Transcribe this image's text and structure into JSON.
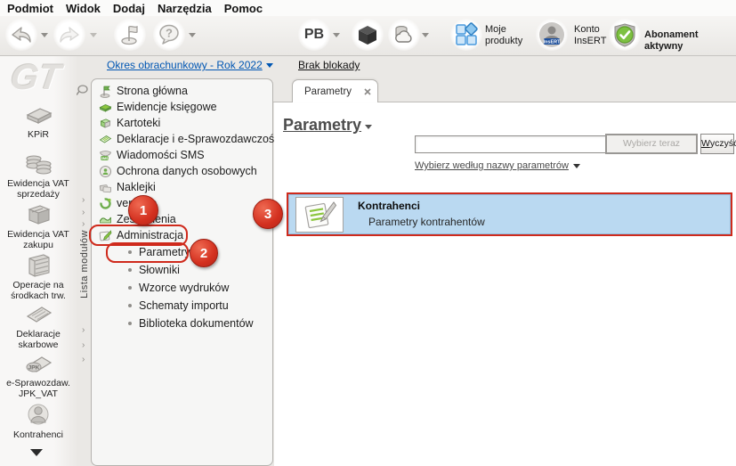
{
  "colors": {
    "accent_red": "#cf2a1c",
    "selection_blue": "#bad9f1",
    "link_blue": "#0056b3",
    "green": "#6fae4e"
  },
  "menu": {
    "items": [
      "Podmiot",
      "Widok",
      "Dodaj",
      "Narzędzia",
      "Pomoc"
    ]
  },
  "toolbar": {
    "pb_label": "PB",
    "moje_produkty_line1": "Moje",
    "moje_produkty_line2": "produkty",
    "konto_line1": "Konto",
    "konto_line2": "InsERT",
    "insert_badge": "InsERT",
    "abonament_label": "Abonament aktywny"
  },
  "icons": {
    "help_glyph": "?",
    "jpk_glyph": "JPK",
    "sms_glyph": "SMS"
  },
  "sidebar": {
    "logo": "GT",
    "strip_label": "Lista modułów",
    "modules": [
      {
        "label": "KPiR"
      },
      {
        "label": "Ewidencja VAT sprzedaży"
      },
      {
        "label": "Ewidencja VAT zakupu"
      },
      {
        "label": "Operacje na środkach trw."
      },
      {
        "label": "Deklaracje skarbowe"
      },
      {
        "label": "e-Sprawozdaw. JPK_VAT"
      },
      {
        "label": "Kontrahenci"
      }
    ]
  },
  "nav": {
    "period_link": "Okres obrachunkowy - Rok 2022",
    "lock_link": "Brak blokady",
    "items": [
      {
        "label": "Strona główna"
      },
      {
        "label": "Ewidencje księgowe"
      },
      {
        "label": "Kartoteki"
      },
      {
        "label": "Deklaracje i e-Sprawozdawczość"
      },
      {
        "label": "Wiadomości SMS"
      },
      {
        "label": "Ochrona danych osobowych"
      },
      {
        "label": "Naklejki"
      },
      {
        "label": "vendero"
      },
      {
        "label": "Zestawienia"
      },
      {
        "label": "Administracja"
      }
    ],
    "subitems": [
      {
        "label": "Parametry"
      },
      {
        "label": "Słowniki"
      },
      {
        "label": "Wzorce wydruków"
      },
      {
        "label": "Schematy importu"
      },
      {
        "label": "Biblioteka dokumentów"
      }
    ]
  },
  "main": {
    "tab_label": "Parametry",
    "heading": "Parametry",
    "search_value": "",
    "select_button": "Wybierz teraz",
    "clear_button_accel": "W",
    "clear_button_rest": "yczyść",
    "filter_link": "Wybierz według nazwy parametrów",
    "list": [
      {
        "title": "Kontrahenci",
        "subtitle": "Parametry kontrahentów"
      }
    ]
  },
  "annotations": {
    "badge1": "1",
    "badge2": "2",
    "badge3": "3"
  }
}
